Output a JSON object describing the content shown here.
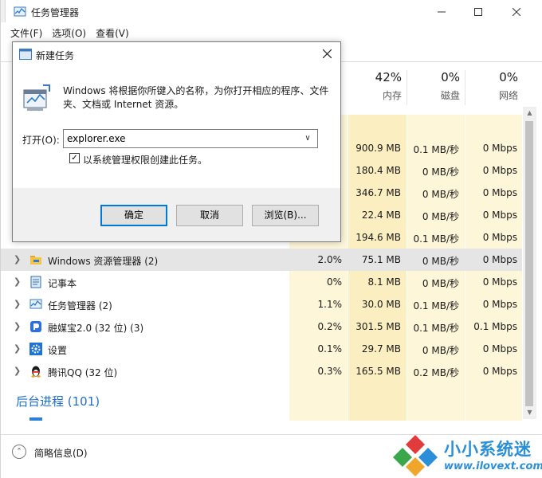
{
  "window": {
    "title": "任务管理器",
    "menu": [
      "文件(F)",
      "选项(O)",
      "查看(V)"
    ]
  },
  "columns": [
    {
      "pct": "42%",
      "label": "内存"
    },
    {
      "pct": "0%",
      "label": "磁盘"
    },
    {
      "pct": "0%",
      "label": "网络"
    }
  ],
  "hidden_rows": [
    {
      "mem": "900.9 MB",
      "disk": "0.1 MB/秒",
      "net": "0 Mbps"
    },
    {
      "mem": "180.4 MB",
      "disk": "0 MB/秒",
      "net": "0 Mbps"
    },
    {
      "mem": "346.7 MB",
      "disk": "0 MB/秒",
      "net": "0 Mbps"
    },
    {
      "mem": "22.4 MB",
      "disk": "0 MB/秒",
      "net": "0 Mbps"
    },
    {
      "mem": "194.6 MB",
      "disk": "0.1 MB/秒",
      "net": "0 Mbps"
    }
  ],
  "apps": [
    {
      "name": "Windows 资源管理器 (2)",
      "icon": "folder-icon",
      "cpu": "2.0%",
      "mem": "75.1 MB",
      "disk": "0 MB/秒",
      "net": "0 Mbps"
    },
    {
      "name": "记事本",
      "icon": "notepad-icon",
      "cpu": "0%",
      "mem": "8.1 MB",
      "disk": "0 MB/秒",
      "net": "0 Mbps"
    },
    {
      "name": "任务管理器 (2)",
      "icon": "task-manager-icon",
      "cpu": "1.1%",
      "mem": "30.0 MB",
      "disk": "0.1 MB/秒",
      "net": "0 Mbps"
    },
    {
      "name": "融媒宝2.0 (32 位) (3)",
      "icon": "rongmeibao-icon",
      "cpu": "0.2%",
      "mem": "301.5 MB",
      "disk": "0.1 MB/秒",
      "net": "0.1 Mbps"
    },
    {
      "name": "设置",
      "icon": "settings-gear-icon",
      "cpu": "0.1%",
      "mem": "29.7 MB",
      "disk": "0 MB/秒",
      "net": "0 Mbps"
    },
    {
      "name": "腾讯QQ (32 位)",
      "icon": "qq-penguin-icon",
      "cpu": "0.3%",
      "mem": "165.5 MB",
      "disk": "0.2 MB/秒",
      "net": "0 Mbps"
    }
  ],
  "background_section": "后台进程 (101)",
  "footer": {
    "fewer_details": "简略信息(D)"
  },
  "watermark": {
    "name": "小小系统迷",
    "url": "www.ilovext.com"
  },
  "run_dialog": {
    "title": "新建任务",
    "description": "Windows 将根据你所键入的名称，为你打开相应的程序、文件夹、文档或 Internet 资源。",
    "open_label": "打开(O):",
    "open_value": "explorer.exe",
    "admin_checkbox": "以系统管理权限创建此任务。",
    "admin_checked": true,
    "ok": "确定",
    "cancel": "取消",
    "browse": "浏览(B)..."
  },
  "colors": {
    "accent": "#1f6fd0",
    "heat_light": "#fdf6d8",
    "heat": "#fbeec1",
    "selected_row": "#e5e5e5"
  }
}
